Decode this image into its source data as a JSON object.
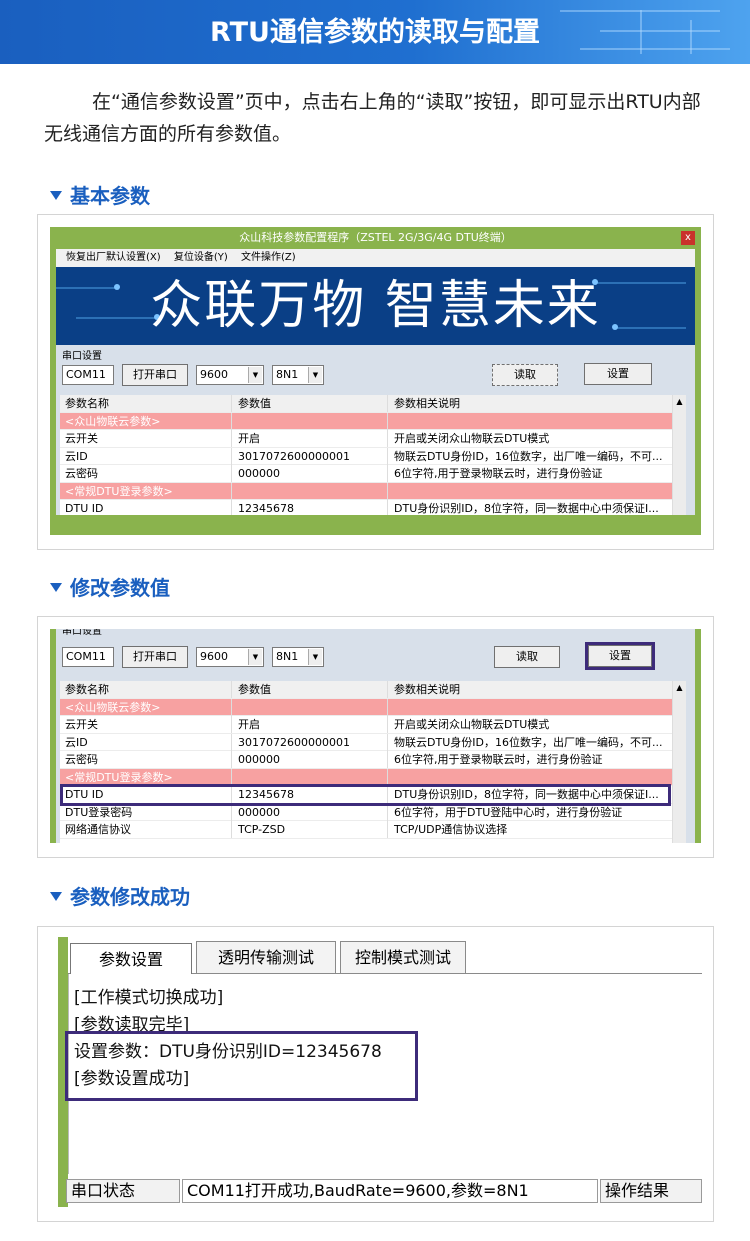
{
  "banner": {
    "title": "RTU通信参数的读取与配置"
  },
  "intro": "在“通信参数设置”页中，点击右上角的“读取”按钮，即可显示出RTU内部无线通信方面的所有参数值。",
  "sections": {
    "basic": "基本参数",
    "modify": "修改参数值",
    "success": "参数修改成功"
  },
  "app": {
    "title": "众山科技参数配置程序（ZSTEL 2G/3G/4G DTU终端）",
    "close": "x",
    "menu": [
      "恢复出厂默认设置(X)",
      "复位设备(Y)",
      "文件操作(Z)"
    ],
    "hero": "众联万物  智慧未来",
    "serial_group": "串口设置",
    "port": "COM11",
    "open_btn": "打开串口",
    "baud": "9600",
    "fmt": "8N1",
    "read_btn": "读取",
    "set_btn": "设置",
    "columns": [
      "参数名称",
      "参数值",
      "参数相关说明"
    ],
    "rows1": [
      [
        "<众山物联云参数>",
        "",
        ""
      ],
      [
        "云开关",
        "开启",
        "开启或关闭众山物联云DTU模式"
      ],
      [
        "云ID",
        "3017072600000001",
        "物联云DTU身份ID，16位数字，出厂唯一编码，不可..."
      ],
      [
        "云密码",
        "000000",
        "6位字符,用于登录物联云时，进行身份验证"
      ],
      [
        "<常规DTU登录参数>",
        "",
        ""
      ],
      [
        "DTU ID",
        "12345678",
        "DTU身份识别ID，8位字符，同一数据中心中须保证I..."
      ]
    ],
    "rows2": [
      [
        "<众山物联云参数>",
        "",
        ""
      ],
      [
        "云开关",
        "开启",
        "开启或关闭众山物联云DTU模式"
      ],
      [
        "云ID",
        "3017072600000001",
        "物联云DTU身份ID，16位数字，出厂唯一编码，不可..."
      ],
      [
        "云密码",
        "000000",
        "6位字符,用于登录物联云时，进行身份验证"
      ],
      [
        "<常规DTU登录参数>",
        "",
        ""
      ],
      [
        "DTU ID",
        "12345678",
        "DTU身份识别ID，8位字符，同一数据中心中须保证I..."
      ],
      [
        "DTU登录密码",
        "000000",
        "6位字符，用于DTU登陆中心时，进行身份验证"
      ],
      [
        "网络通信协议",
        "TCP-ZSD",
        "TCP/UDP通信协议选择"
      ]
    ]
  },
  "log_panel": {
    "tabs": [
      "参数设置",
      "透明传输测试",
      "控制模式测试"
    ],
    "lines": [
      "[工作模式切换成功]",
      "[参数读取完毕]",
      "设置参数：DTU身份识别ID=12345678",
      "[参数设置成功]"
    ],
    "status_label": "串口状态",
    "status_text": "COM11打开成功,BaudRate=9600,参数=8N1",
    "result_label": "操作结果"
  }
}
